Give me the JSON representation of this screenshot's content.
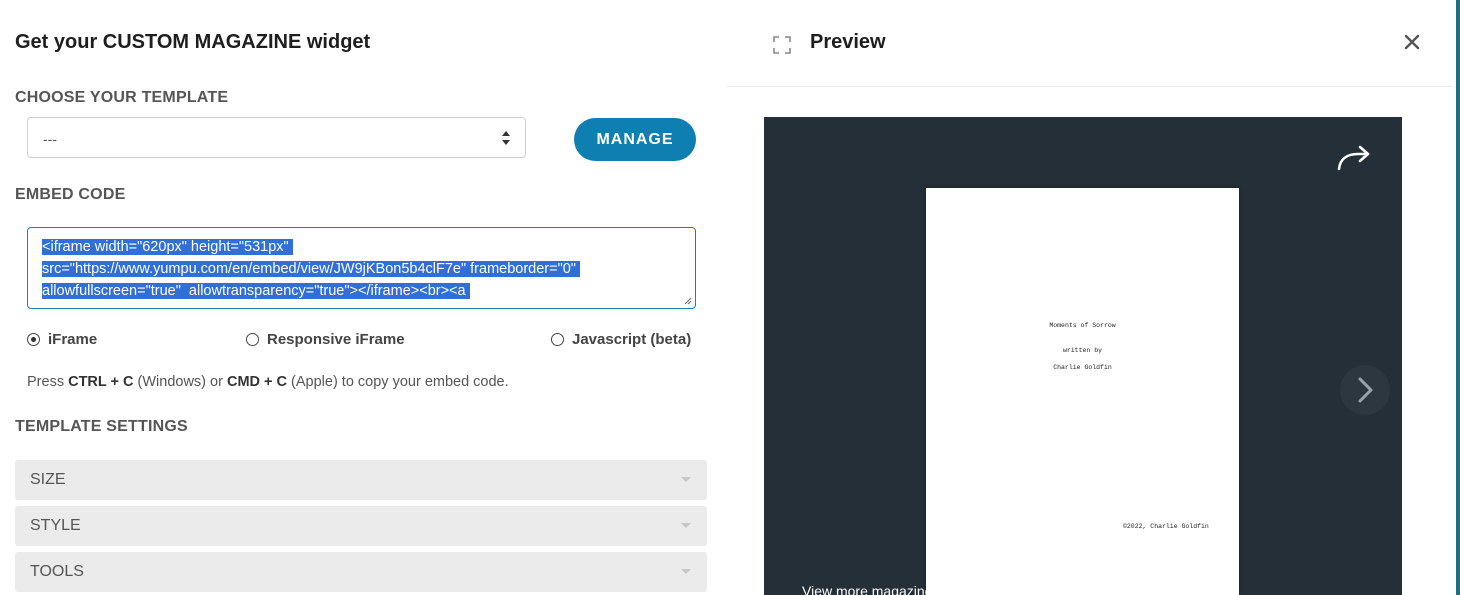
{
  "widget": {
    "title": "Get your CUSTOM MAGAZINE widget",
    "choose_template_label": "CHOOSE YOUR TEMPLATE",
    "template_select_value": "---",
    "manage_button": "MANAGE",
    "embed_code_label": "EMBED CODE",
    "embed_code": "<iframe width=\"620px\" height=\"531px\" src=\"https://www.yumpu.com/en/embed/view/JW9jKBon5b4clF7e\" frameborder=\"0\" allowfullscreen=\"true\"  allowtransparency=\"true\"></iframe><br><a",
    "embed_lines": [
      "<iframe width=\"620px\" height=\"531px\" ",
      "src=\"https://www.yumpu.com/en/embed/view/JW9jKBon5b4clF7e\" frameborder=\"0\" ",
      "allowfullscreen=\"true\"  allowtransparency=\"true\"></iframe><br><a "
    ],
    "embed_options": [
      {
        "label": "iFrame",
        "selected": true
      },
      {
        "label": "Responsive iFrame",
        "selected": false
      },
      {
        "label": "Javascript (beta)",
        "selected": false
      }
    ],
    "hint": {
      "press": "Press ",
      "ctrl_c": "CTRL + C",
      "windows": " (Windows) or ",
      "cmd_c": "CMD + C",
      "apple": " (Apple) to copy your embed code."
    },
    "template_settings_label": "TEMPLATE SETTINGS",
    "settings_sections": [
      "SIZE",
      "STYLE",
      "TOOLS"
    ]
  },
  "preview": {
    "title": "Preview",
    "page_lines": {
      "title": "Moments of Sorrow",
      "written_by": "written by",
      "author": "Charlie Goldfin",
      "copyright": "©2022, Charlie Goldfin"
    },
    "view_more": "View more magazines"
  },
  "colors": {
    "accent": "#0e7fb0",
    "selection": "#2f6fd6",
    "stage_bg": "#242f37"
  },
  "icons": {
    "expand": "expand-icon",
    "close": "close-icon",
    "share": "share-arrow-icon",
    "next": "chevron-right-icon",
    "select": "sort-arrows-icon"
  }
}
